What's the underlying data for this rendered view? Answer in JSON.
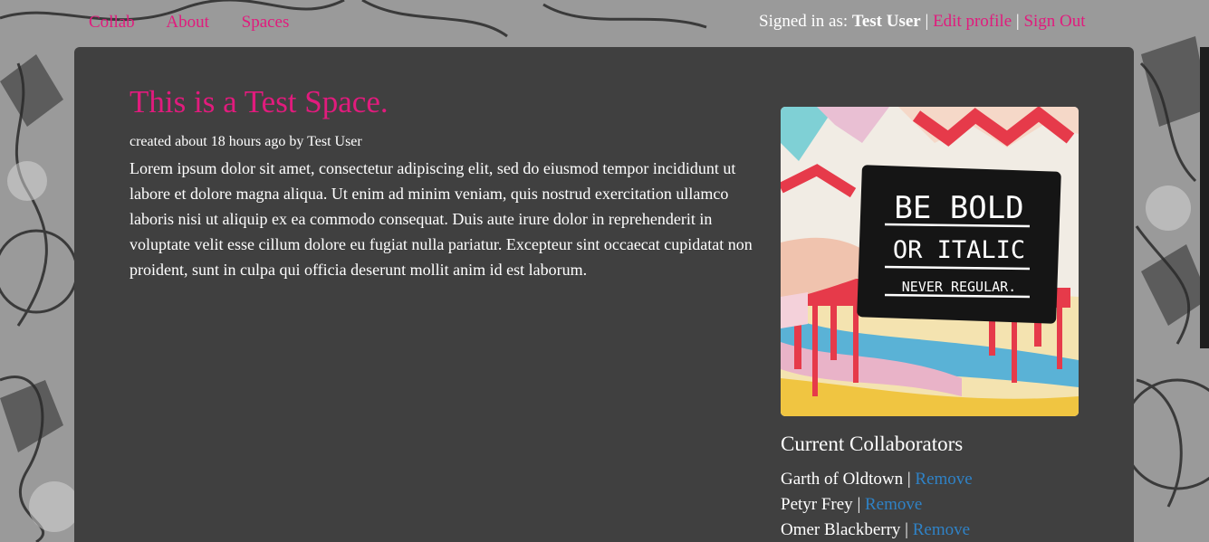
{
  "nav": {
    "brand": "Collab",
    "about": "About",
    "spaces": "Spaces"
  },
  "userbar": {
    "prefix": "Signed in as: ",
    "username": "Test User",
    "separator": " | ",
    "edit_profile": "Edit profile",
    "sign_out": "Sign Out"
  },
  "space": {
    "title": "This is a Test Space.",
    "meta": "created about 18 hours ago by Test User",
    "description": "Lorem ipsum dolor sit amet, consectetur adipiscing elit, sed do eiusmod tempor incididunt ut labore et dolore magna aliqua. Ut enim ad minim veniam, quis nostrud exercitation ullamco laboris nisi ut aliquip ex ea commodo consequat. Duis aute irure dolor in reprehenderit in voluptate velit esse cillum dolore eu fugiat nulla pariatur. Excepteur sint occaecat cupidatat non proident, sunt in culpa qui officia deserunt mollit anim id est laborum.",
    "image_text": [
      "BE BOLD",
      "OR ITALIC",
      "NEVER REGULAR."
    ]
  },
  "collaborators": {
    "heading": "Current Collaborators",
    "separator": " | ",
    "remove_label": "Remove",
    "items": [
      {
        "name": "Garth of Oldtown"
      },
      {
        "name": "Petyr Frey"
      },
      {
        "name": "Omer Blackberry"
      }
    ]
  },
  "colors": {
    "accent": "#e11b7d",
    "link": "#2f82c6",
    "panel": "#404040"
  }
}
